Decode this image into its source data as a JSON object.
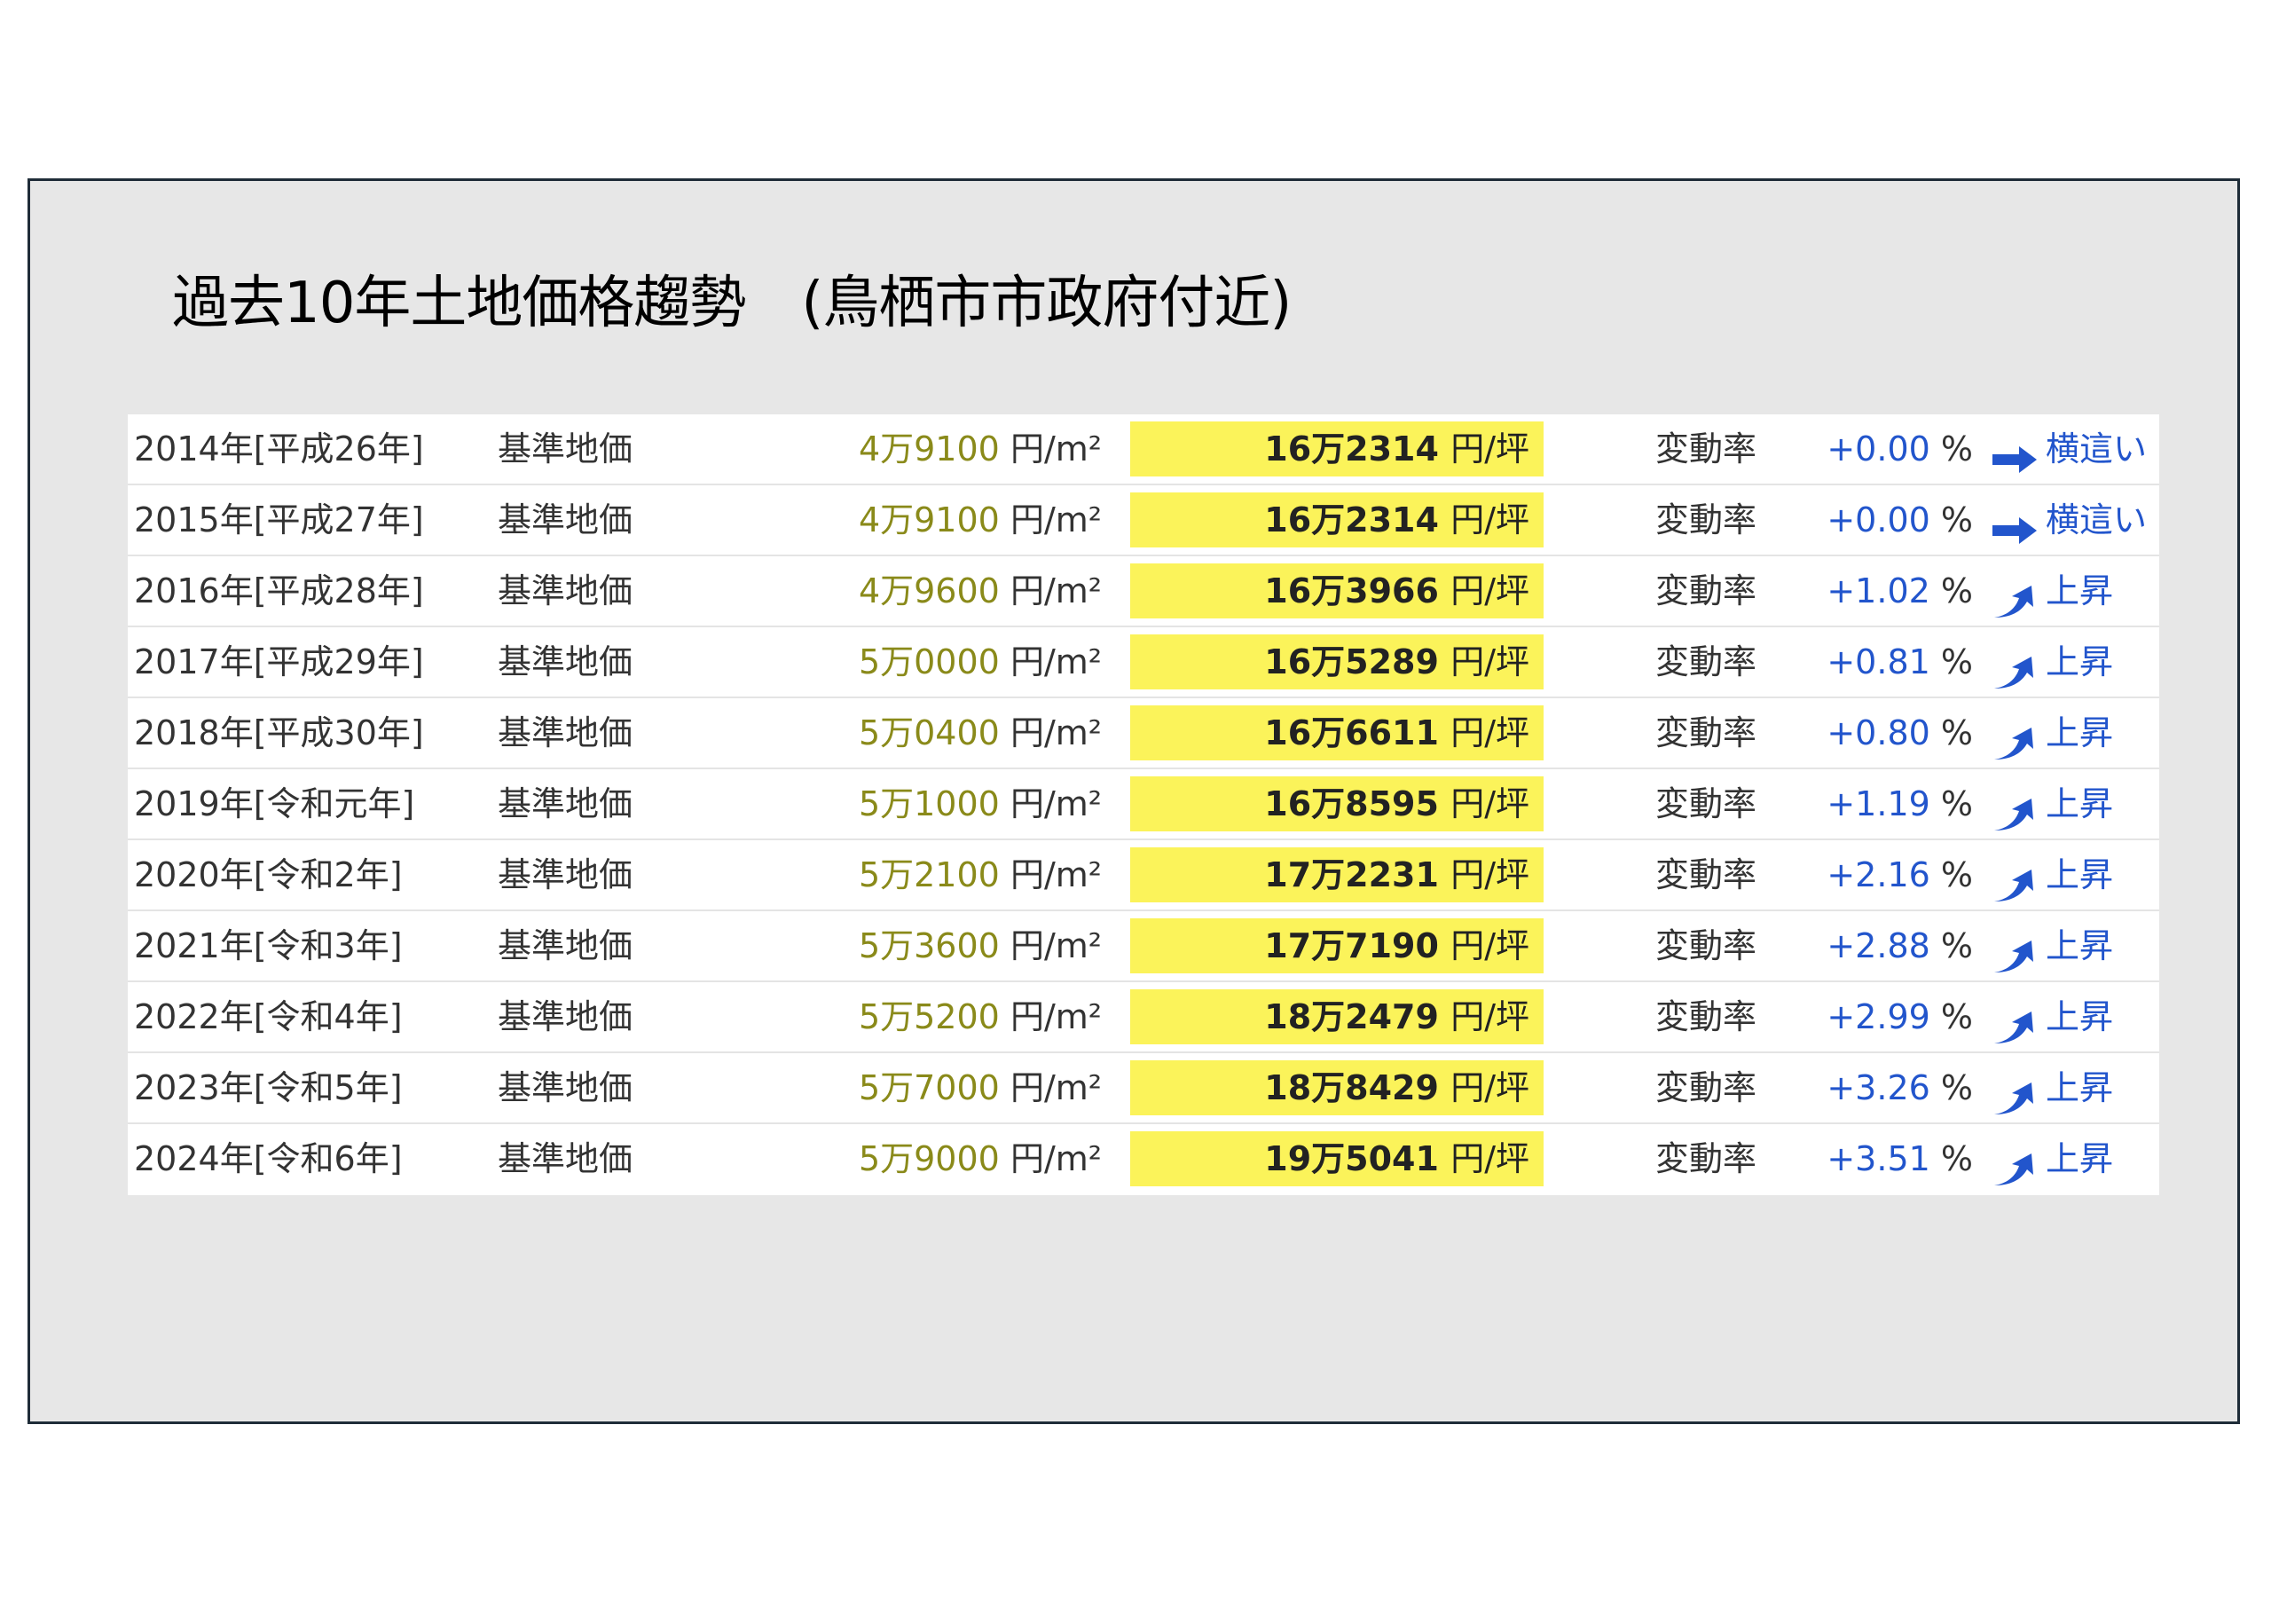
{
  "title": "過去10年土地価格趨勢　(鳥栖市市政府付近)",
  "colors": {
    "slide_bg": "#e7e7e7",
    "highlight": "#fbf35a",
    "accent_blue": "#2255cc",
    "olive_value": "#8a8a1a"
  },
  "table": {
    "rows": [
      {
        "year": "2014年[平成26年]",
        "kind": "基準地価",
        "sqm": "4万9100",
        "sqm_unit": "円/m²",
        "tsubo": "16万2314",
        "tsubo_unit": "円/坪",
        "label": "変動率",
        "rate": "+0.00",
        "pct": "%",
        "trend": "横這い",
        "icon": "arrow-right-icon"
      },
      {
        "year": "2015年[平成27年]",
        "kind": "基準地価",
        "sqm": "4万9100",
        "sqm_unit": "円/m²",
        "tsubo": "16万2314",
        "tsubo_unit": "円/坪",
        "label": "変動率",
        "rate": "+0.00",
        "pct": "%",
        "trend": "横這い",
        "icon": "arrow-right-icon"
      },
      {
        "year": "2016年[平成28年]",
        "kind": "基準地価",
        "sqm": "4万9600",
        "sqm_unit": "円/m²",
        "tsubo": "16万3966",
        "tsubo_unit": "円/坪",
        "label": "変動率",
        "rate": "+1.02",
        "pct": "%",
        "trend": "上昇",
        "icon": "arrow-up-right-icon"
      },
      {
        "year": "2017年[平成29年]",
        "kind": "基準地価",
        "sqm": "5万0000",
        "sqm_unit": "円/m²",
        "tsubo": "16万5289",
        "tsubo_unit": "円/坪",
        "label": "変動率",
        "rate": "+0.81",
        "pct": "%",
        "trend": "上昇",
        "icon": "arrow-up-right-icon"
      },
      {
        "year": "2018年[平成30年]",
        "kind": "基準地価",
        "sqm": "5万0400",
        "sqm_unit": "円/m²",
        "tsubo": "16万6611",
        "tsubo_unit": "円/坪",
        "label": "変動率",
        "rate": "+0.80",
        "pct": "%",
        "trend": "上昇",
        "icon": "arrow-up-right-icon"
      },
      {
        "year": "2019年[令和元年]",
        "kind": "基準地価",
        "sqm": "5万1000",
        "sqm_unit": "円/m²",
        "tsubo": "16万8595",
        "tsubo_unit": "円/坪",
        "label": "変動率",
        "rate": "+1.19",
        "pct": "%",
        "trend": "上昇",
        "icon": "arrow-up-right-icon"
      },
      {
        "year": "2020年[令和2年]",
        "kind": "基準地価",
        "sqm": "5万2100",
        "sqm_unit": "円/m²",
        "tsubo": "17万2231",
        "tsubo_unit": "円/坪",
        "label": "変動率",
        "rate": "+2.16",
        "pct": "%",
        "trend": "上昇",
        "icon": "arrow-up-right-icon"
      },
      {
        "year": "2021年[令和3年]",
        "kind": "基準地価",
        "sqm": "5万3600",
        "sqm_unit": "円/m²",
        "tsubo": "17万7190",
        "tsubo_unit": "円/坪",
        "label": "変動率",
        "rate": "+2.88",
        "pct": "%",
        "trend": "上昇",
        "icon": "arrow-up-right-icon"
      },
      {
        "year": "2022年[令和4年]",
        "kind": "基準地価",
        "sqm": "5万5200",
        "sqm_unit": "円/m²",
        "tsubo": "18万2479",
        "tsubo_unit": "円/坪",
        "label": "変動率",
        "rate": "+2.99",
        "pct": "%",
        "trend": "上昇",
        "icon": "arrow-up-right-icon"
      },
      {
        "year": "2023年[令和5年]",
        "kind": "基準地価",
        "sqm": "5万7000",
        "sqm_unit": "円/m²",
        "tsubo": "18万8429",
        "tsubo_unit": "円/坪",
        "label": "変動率",
        "rate": "+3.26",
        "pct": "%",
        "trend": "上昇",
        "icon": "arrow-up-right-icon"
      },
      {
        "year": "2024年[令和6年]",
        "kind": "基準地価",
        "sqm": "5万9000",
        "sqm_unit": "円/m²",
        "tsubo": "19万5041",
        "tsubo_unit": "円/坪",
        "label": "変動率",
        "rate": "+3.51",
        "pct": "%",
        "trend": "上昇",
        "icon": "arrow-up-right-icon"
      }
    ]
  }
}
